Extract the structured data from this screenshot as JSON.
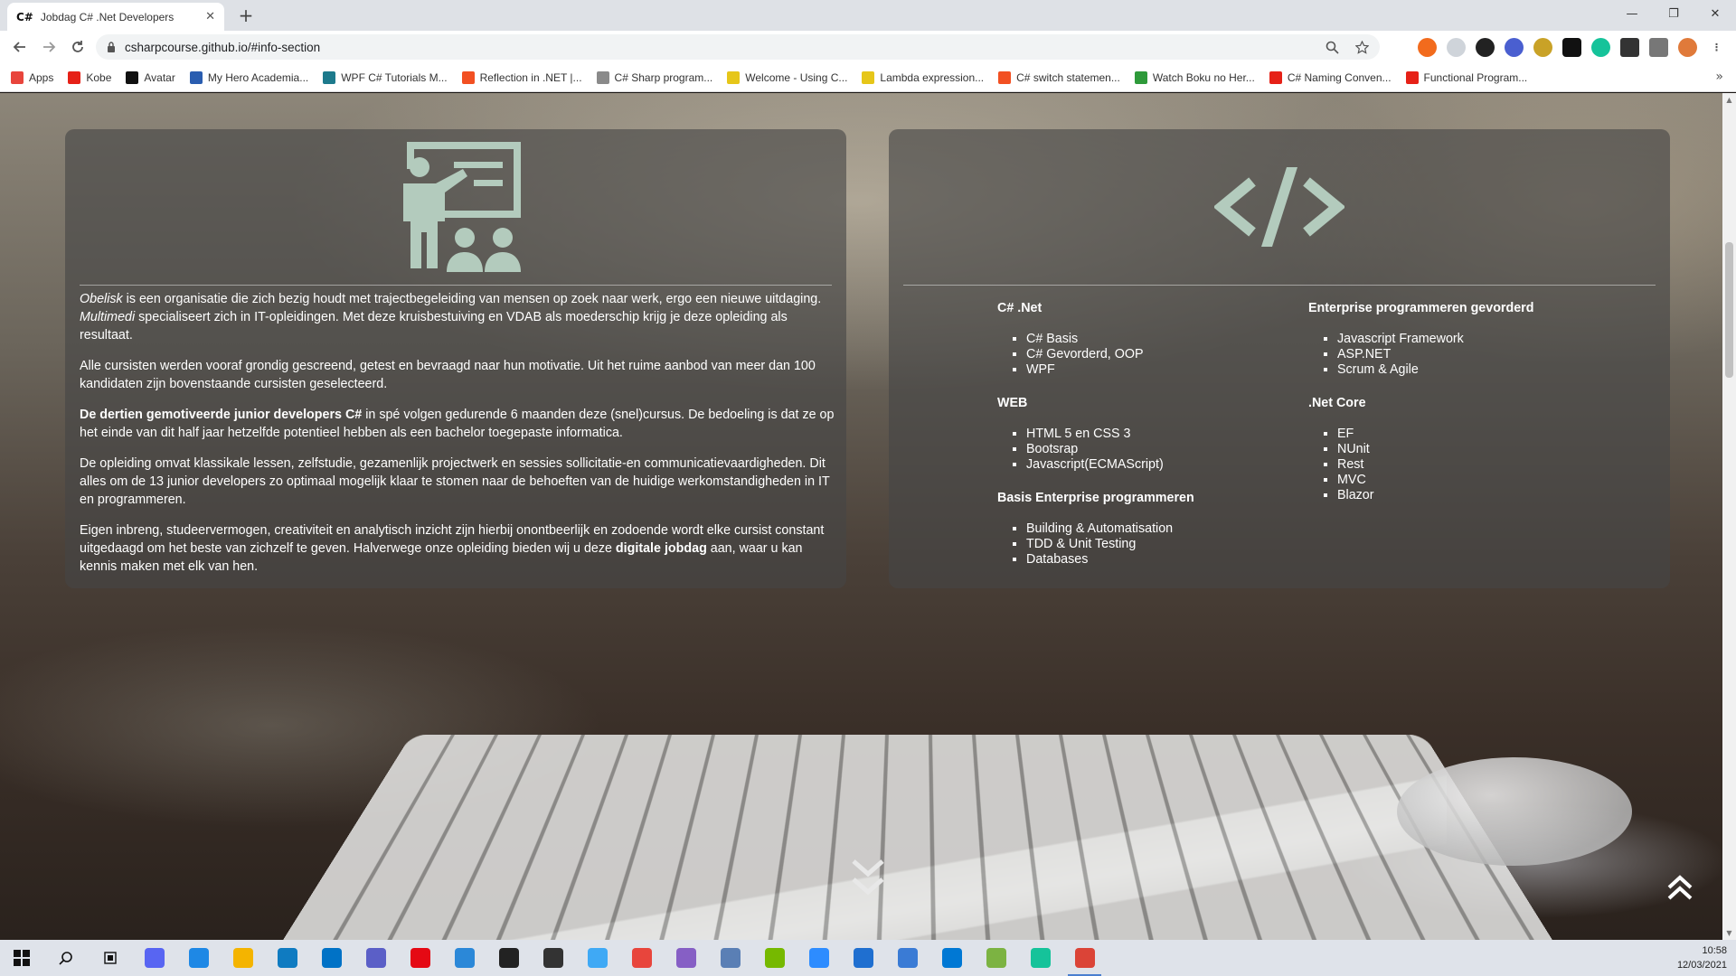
{
  "browser": {
    "tab_favicon": "C#",
    "tab_title": "Jobdag C# .Net Developers",
    "tab_close": "✕",
    "new_tab": "+",
    "url": "csharpcourse.github.io/#info-section",
    "window_minimize": "—",
    "window_restore": "❐",
    "window_close": "✕"
  },
  "bookmarks": [
    {
      "label": "Apps",
      "color": "#e8453c",
      "icon": "apps-grid-icon"
    },
    {
      "label": "Kobe",
      "color": "#e62117",
      "icon": "youtube-icon"
    },
    {
      "label": "Avatar",
      "color": "#111111",
      "icon": "avatar-icon"
    },
    {
      "label": "My Hero Academia...",
      "color": "#2a5db0",
      "icon": "bookmark-icon"
    },
    {
      "label": "WPF C# Tutorials M...",
      "color": "#1d7a8c",
      "icon": "bookmark-icon"
    },
    {
      "label": "Reflection in .NET |...",
      "color": "#f25022",
      "icon": "microsoft-icon"
    },
    {
      "label": "C# Sharp program...",
      "color": "#8a8a8a",
      "icon": "w3r-icon"
    },
    {
      "label": "Welcome - Using C...",
      "color": "#e6c619",
      "icon": "bookmark-icon"
    },
    {
      "label": "Lambda expression...",
      "color": "#e6c619",
      "icon": "bookmark-icon"
    },
    {
      "label": "C# switch statemen...",
      "color": "#f25022",
      "icon": "microsoft-icon"
    },
    {
      "label": "Watch Boku no Her...",
      "color": "#2e9a3a",
      "icon": "bookmark-icon"
    },
    {
      "label": "C# Naming Conven...",
      "color": "#e62117",
      "icon": "youtube-icon"
    },
    {
      "label": "Functional Program...",
      "color": "#e62117",
      "icon": "youtube-icon"
    }
  ],
  "info": {
    "p1_italic1": "Obelisk",
    "p1_text1": " is een organisatie die zich bezig houdt met trajectbegeleiding van mensen op zoek naar werk, ergo een nieuwe uitdaging. ",
    "p1_italic2": "Multimedi",
    "p1_text2": " specialiseert zich in IT-opleidingen. Met deze kruisbestuiving en VDAB als moederschip krijg je deze opleiding als resultaat.",
    "p2": "Alle cursisten werden vooraf grondig gescreend, getest en bevraagd naar hun motivatie. Uit het ruime aanbod van meer dan 100 kandidaten zijn bovenstaande cursisten geselecteerd.",
    "p3_bold": "De dertien gemotiveerde junior developers C#",
    "p3_text": " in spé volgen gedurende 6 maanden deze (snel)cursus. De bedoeling is dat ze op het einde van dit half jaar hetzelfde potentieel hebben als een bachelor toegepaste informatica.",
    "p4": "De opleiding omvat klassikale lessen, zelfstudie, gezamenlijk projectwerk en sessies sollicitatie-en communicatievaardigheden. Dit alles om de 13 junior developers zo optimaal mogelijk klaar te stomen naar de behoeften van de huidige werkomstandigheden in IT en programmeren.",
    "p5_text1": "Eigen inbreng, studeervermogen, creativiteit en analytisch inzicht zijn hierbij onontbeerlijk en zodoende wordt elke cursist constant uitgedaagd om het beste van zichzelf te geven. Halverwege onze opleiding bieden wij u deze ",
    "p5_bold": "digitale jobdag",
    "p5_text2": " aan, waar u kan kennis maken met elk van hen."
  },
  "curriculum": {
    "col1": [
      {
        "heading": "C# .Net",
        "items": [
          "C# Basis",
          "C# Gevorderd, OOP",
          "WPF"
        ]
      },
      {
        "heading": "WEB",
        "items": [
          "HTML 5 en CSS 3",
          "Bootsrap",
          "Javascript(ECMAScript)"
        ]
      },
      {
        "heading": "Basis Enterprise programmeren",
        "items": [
          "Building & Automatisation",
          "TDD & Unit Testing",
          "Databases"
        ]
      }
    ],
    "col2": [
      {
        "heading": "Enterprise programmeren gevorderd",
        "items": [
          "Javascript Framework",
          "ASP.NET",
          "Scrum & Agile"
        ]
      },
      {
        "heading": ".Net Core",
        "items": [
          "EF",
          "NUnit",
          "Rest",
          "MVC",
          "Blazor"
        ]
      }
    ]
  },
  "colors": {
    "icon_mint": "#b3cbbd",
    "card_bg": "rgba(70,70,70,0.62)"
  },
  "taskbar": {
    "items": [
      {
        "icon": "search-icon",
        "color": "#dfe3ea"
      },
      {
        "icon": "task-view-icon",
        "color": "#dfe3ea"
      },
      {
        "icon": "discord-icon",
        "color": "#5865f2"
      },
      {
        "icon": "app-icon",
        "color": "#1e88e5"
      },
      {
        "icon": "file-explorer-icon",
        "color": "#f4b400"
      },
      {
        "icon": "edge-icon",
        "color": "#0f7bc1"
      },
      {
        "icon": "mail-icon",
        "color": "#0072c6"
      },
      {
        "icon": "teams-icon",
        "color": "#5b5fc7"
      },
      {
        "icon": "netflix-icon",
        "color": "#e50914"
      },
      {
        "icon": "app-icon",
        "color": "#2b88d8"
      },
      {
        "icon": "g-hub-icon",
        "color": "#222222"
      },
      {
        "icon": "app-icon",
        "color": "#333333"
      },
      {
        "icon": "app-icon",
        "color": "#3fa9f5"
      },
      {
        "icon": "app-icon",
        "color": "#e8453c"
      },
      {
        "icon": "visual-studio-icon",
        "color": "#865fc5"
      },
      {
        "icon": "app-icon",
        "color": "#5a7fb5"
      },
      {
        "icon": "nvidia-icon",
        "color": "#76b900"
      },
      {
        "icon": "zoom-icon",
        "color": "#2d8cff"
      },
      {
        "icon": "app-icon",
        "color": "#1f6fd0"
      },
      {
        "icon": "app-icon",
        "color": "#3a7bd5"
      },
      {
        "icon": "vscode-icon",
        "color": "#0078d4"
      },
      {
        "icon": "app-icon",
        "color": "#7cb342"
      },
      {
        "icon": "grammarly-icon",
        "color": "#15c39a"
      },
      {
        "icon": "chrome-icon",
        "color": "#db4437"
      }
    ],
    "time": "10:58",
    "date": "12/03/2021"
  }
}
